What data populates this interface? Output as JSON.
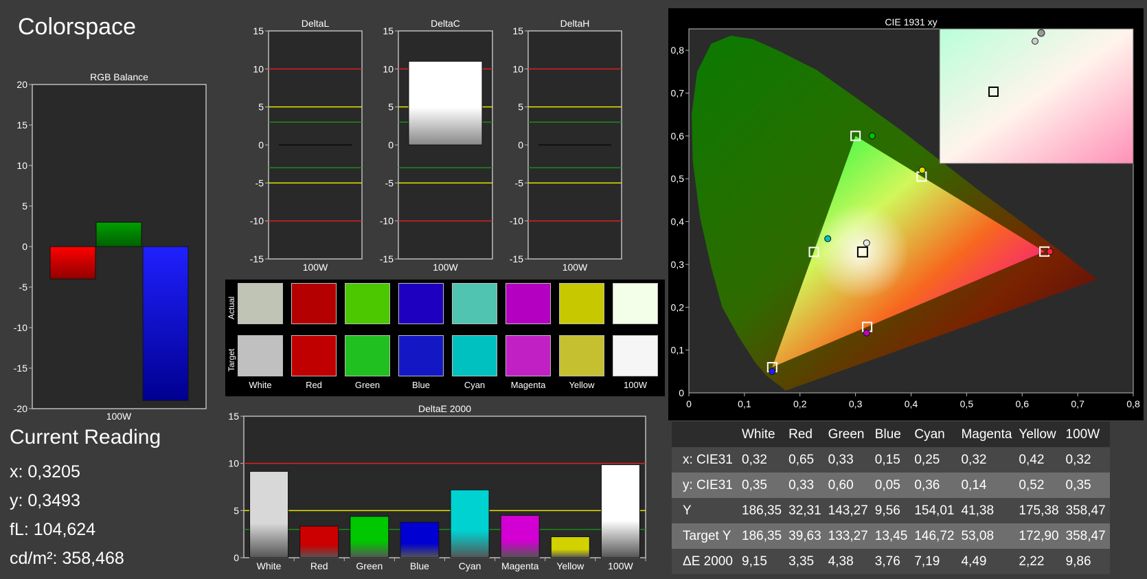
{
  "page_title": "Colorspace",
  "current_reading": {
    "heading": "Current Reading",
    "lines": [
      "x: 0,3205",
      "y: 0,3493",
      "fL: 104,624",
      "cd/m²: 358,468"
    ]
  },
  "chart_data": [
    {
      "id": "rgb-balance",
      "type": "bar",
      "title": "RGB Balance",
      "xlabel": "100W",
      "ylim": [
        -20,
        20
      ],
      "yticks": [
        "20",
        "15",
        "10",
        "5",
        "0",
        "-5",
        "-10",
        "-15",
        "-20"
      ],
      "categories": [
        "Red",
        "Green",
        "Blue"
      ],
      "values": [
        -4,
        3,
        -19
      ],
      "colors": [
        "#ff0000",
        "#008c00",
        "#1414ff"
      ]
    },
    {
      "id": "delta-l",
      "type": "bar",
      "title": "DeltaL",
      "xlabel": "100W",
      "ylim": [
        -15,
        15
      ],
      "yticks": [
        "15",
        "10",
        "5",
        "0",
        "-5",
        "-10",
        "-15"
      ],
      "values": [
        0
      ]
    },
    {
      "id": "delta-c",
      "type": "bar",
      "title": "DeltaC",
      "xlabel": "100W",
      "ylim": [
        -15,
        15
      ],
      "yticks": [
        "15",
        "10",
        "5",
        "0",
        "-5",
        "-10",
        "-15"
      ],
      "values": [
        11
      ]
    },
    {
      "id": "delta-h",
      "type": "bar",
      "title": "DeltaH",
      "xlabel": "100W",
      "ylim": [
        -15,
        15
      ],
      "yticks": [
        "15",
        "10",
        "5",
        "0",
        "-5",
        "-10",
        "-15"
      ],
      "values": [
        0
      ]
    },
    {
      "id": "delta-e-2000",
      "type": "bar",
      "title": "DeltaE 2000",
      "ylim": [
        0,
        15
      ],
      "yticks": [
        "15",
        "10",
        "5",
        "0"
      ],
      "categories": [
        "White",
        "Red",
        "Green",
        "Blue",
        "Cyan",
        "Magenta",
        "Yellow",
        "100W"
      ],
      "values": [
        9.15,
        3.35,
        4.38,
        3.76,
        7.19,
        4.49,
        2.22,
        9.86
      ],
      "colors": [
        "#d8d8d8",
        "#cc0000",
        "#00c800",
        "#0000d2",
        "#00d2d2",
        "#d200d2",
        "#d2d200",
        "#ffffff"
      ]
    },
    {
      "id": "cie-1931",
      "type": "scatter",
      "title": "CIE 1931 xy",
      "xlim": [
        0,
        0.8
      ],
      "ylim": [
        0,
        0.85
      ],
      "xticks": [
        "0",
        "0,1",
        "0,2",
        "0,3",
        "0,4",
        "0,5",
        "0,6",
        "0,7",
        "0,8"
      ],
      "yticks": [
        "0,1",
        "0,2",
        "0,3",
        "0,4",
        "0,5",
        "0,6",
        "0,7",
        "0,8"
      ],
      "series": [
        {
          "name": "Target",
          "points": [
            [
              0.64,
              0.33
            ],
            [
              0.3,
              0.6
            ],
            [
              0.15,
              0.06
            ],
            [
              0.225,
              0.329
            ],
            [
              0.321,
              0.154
            ],
            [
              0.419,
              0.505
            ],
            [
              0.3127,
              0.329
            ]
          ]
        },
        {
          "name": "Actual",
          "points": [
            [
              0.65,
              0.33
            ],
            [
              0.33,
              0.6
            ],
            [
              0.15,
              0.05
            ],
            [
              0.25,
              0.36
            ],
            [
              0.32,
              0.14
            ],
            [
              0.42,
              0.52
            ],
            [
              0.32,
              0.35
            ]
          ]
        }
      ]
    }
  ],
  "swatches": {
    "actual_label": "Actual",
    "target_label": "Target",
    "names": [
      "White",
      "Red",
      "Green",
      "Blue",
      "Cyan",
      "Magenta",
      "Yellow",
      "100W"
    ],
    "actual_colors": [
      "#c0c4b4",
      "#b40000",
      "#4cc800",
      "#1e00c0",
      "#50c4b0",
      "#b400c0",
      "#c8c800",
      "#f4ffea"
    ],
    "target_colors": [
      "#c0c0c0",
      "#c00000",
      "#20c020",
      "#1418c4",
      "#00c0c0",
      "#c020c4",
      "#c4c030",
      "#f6f6f6"
    ]
  },
  "table": {
    "headers": [
      "",
      "White",
      "Red",
      "Green",
      "Blue",
      "Cyan",
      "Magenta",
      "Yellow",
      "100W"
    ],
    "rows": [
      [
        "x: CIE31",
        "0,32",
        "0,65",
        "0,33",
        "0,15",
        "0,25",
        "0,32",
        "0,42",
        "0,32"
      ],
      [
        "y: CIE31",
        "0,35",
        "0,33",
        "0,60",
        "0,05",
        "0,36",
        "0,14",
        "0,52",
        "0,35"
      ],
      [
        "Y",
        "186,35",
        "32,31",
        "143,27",
        "9,56",
        "154,01",
        "41,38",
        "175,38",
        "358,47"
      ],
      [
        "Target Y",
        "186,35",
        "39,63",
        "133,27",
        "13,45",
        "146,72",
        "53,08",
        "172,90",
        "358,47"
      ],
      [
        "ΔE 2000",
        "9,15",
        "3,35",
        "4,38",
        "3,76",
        "7,19",
        "4,49",
        "2,22",
        "9,86"
      ]
    ]
  }
}
